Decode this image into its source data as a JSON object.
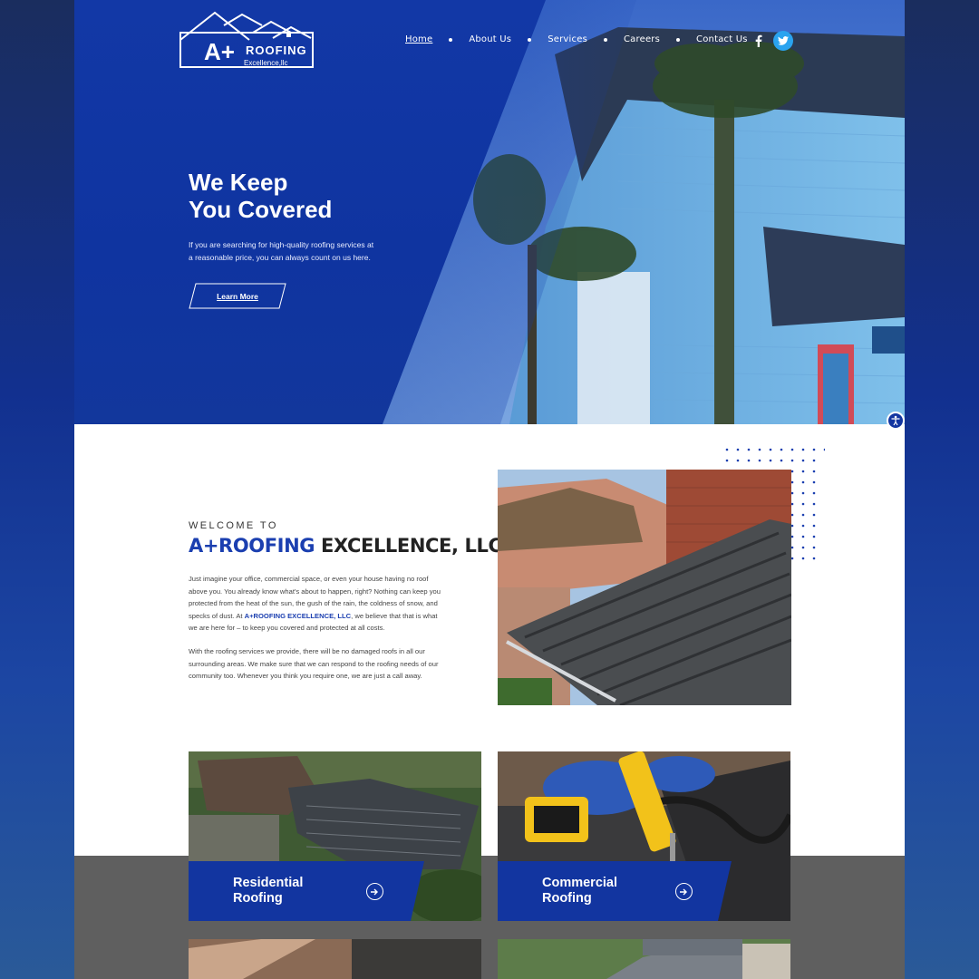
{
  "brand": {
    "logo_main": "A+",
    "logo_word": "ROOFING",
    "logo_sub": "Excellence,llc"
  },
  "nav": {
    "items": [
      {
        "label": "Home",
        "active": true
      },
      {
        "label": "About Us"
      },
      {
        "label": "Services"
      },
      {
        "label": "Careers"
      },
      {
        "label": "Contact Us"
      }
    ]
  },
  "social": {
    "facebook_icon": "facebook-icon",
    "twitter_icon": "twitter-icon"
  },
  "hero": {
    "title": "We Keep\nYou Covered",
    "text": "If you are searching for high-quality roofing services at a reasonable price, you can always count on us here.",
    "cta": "Learn More"
  },
  "welcome": {
    "kicker": "WELCOME TO",
    "brand": "A+ROOFING",
    "rest": " EXCELLENCE, LLC",
    "p1_a": "Just imagine your office, commercial space, or even your house having no roof above you. You already know what's about to happen, right? Nothing can keep you protected from the heat of the sun, the gush of the rain, the coldness of snow, and specks of dust. At ",
    "p1_brand": "A+ROOFING EXCELLENCE, LLC",
    "p1_b": ", we believe that that is what we are here for – to keep you covered and protected at all costs.",
    "p2": "With the roofing services we provide, there will be no damaged roofs in all our surrounding areas. We make sure that we can respond to the roofing needs of our community too. Whenever you think you require one, we are just a call away."
  },
  "services": [
    {
      "label": "Residential\nRoofing"
    },
    {
      "label": "Commercial\nRoofing"
    }
  ],
  "colors": {
    "primary": "#1235a0",
    "accent_brand": "#1b3fb0",
    "gray_band": "#5f5f5f"
  }
}
